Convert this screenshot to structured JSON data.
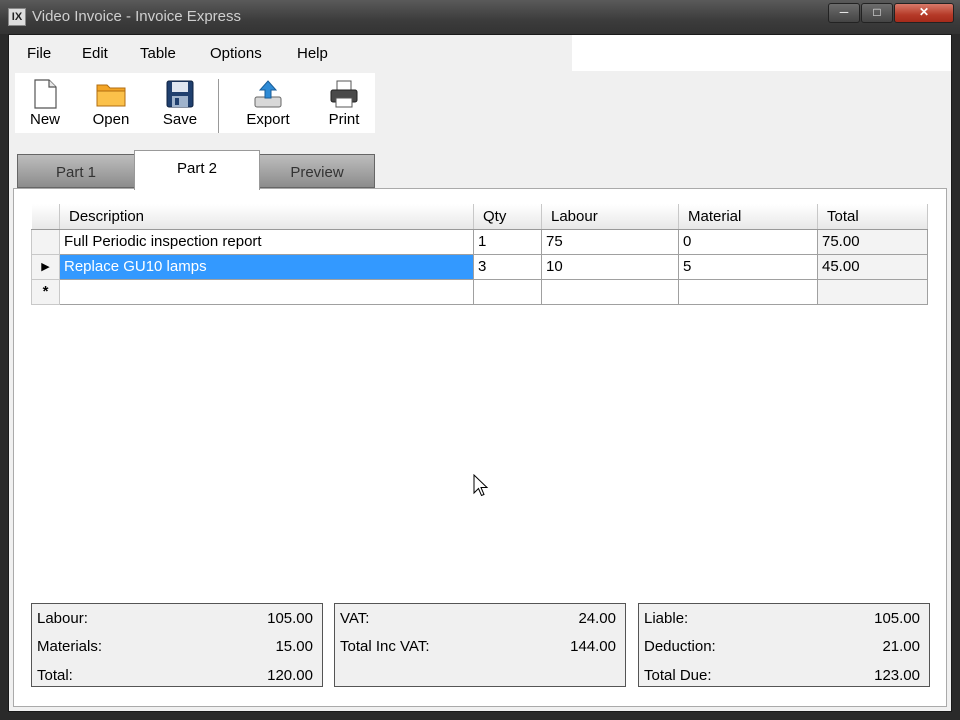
{
  "window": {
    "app_icon": "IX",
    "title": "Video Invoice - Invoice Express"
  },
  "menu": [
    "File",
    "Edit",
    "Table",
    "Options",
    "Help"
  ],
  "toolbar": {
    "new": "New",
    "open": "Open",
    "save": "Save",
    "export": "Export",
    "print": "Print"
  },
  "tabs": [
    "Part 1",
    "Part 2",
    "Preview"
  ],
  "active_tab": "Part 2",
  "grid": {
    "columns": [
      "Description",
      "Qty",
      "Labour",
      "Material",
      "Total"
    ],
    "rows": [
      {
        "description": "Full Periodic inspection report",
        "qty": "1",
        "labour": "75",
        "material": "0",
        "total": "75.00"
      },
      {
        "description": "Replace GU10 lamps",
        "qty": "3",
        "labour": "10",
        "material": "5",
        "total": "45.00"
      }
    ],
    "current_row_marker": "▶",
    "new_row_marker": "*"
  },
  "summary": {
    "left": [
      {
        "label": "Labour:",
        "value": "105.00"
      },
      {
        "label": "Materials:",
        "value": "15.00"
      },
      {
        "label": "Total:",
        "value": "120.00"
      }
    ],
    "middle": [
      {
        "label": "VAT:",
        "value": "24.00"
      },
      {
        "label": "Total Inc VAT:",
        "value": "144.00"
      }
    ],
    "right": [
      {
        "label": "Liable:",
        "value": "105.00"
      },
      {
        "label": "Deduction:",
        "value": "21.00"
      },
      {
        "label": "Total Due:",
        "value": "123.00"
      }
    ]
  },
  "colors": {
    "selection": "#3399ff",
    "close_button": "#b53a28"
  }
}
